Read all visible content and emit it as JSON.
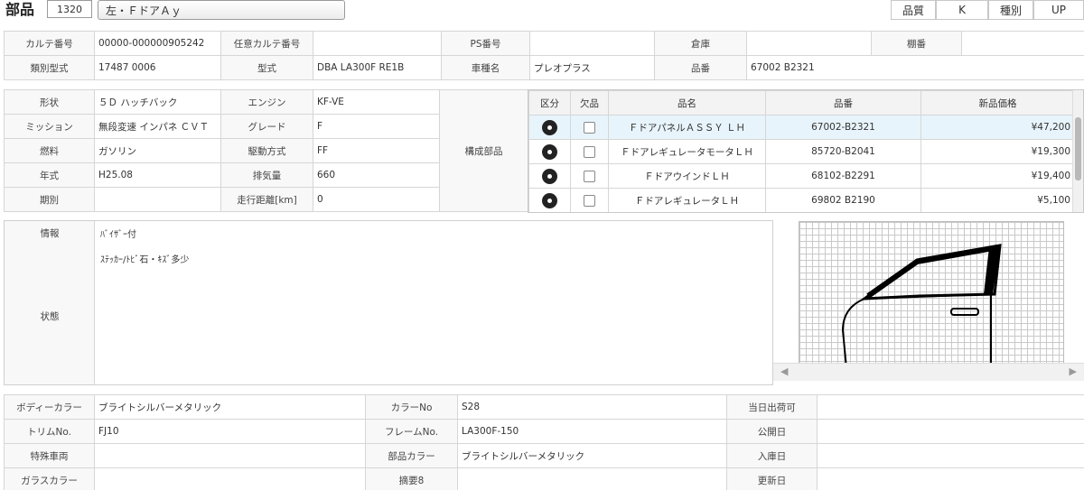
{
  "header": {
    "title": "部品",
    "code": "1320",
    "part_name": "左・ＦドアＡｙ",
    "quality_label": "品質",
    "quality_value": "K",
    "type_label": "種別",
    "type_value": "UP"
  },
  "row1": {
    "karte_no_label": "カルテ番号",
    "karte_no_value": "00000-000000905242",
    "any_karte_label": "任意カルテ番号",
    "any_karte_value": "",
    "ps_no_label": "PS番号",
    "ps_no_value": "",
    "warehouse_label": "倉庫",
    "warehouse_value": "",
    "shelf_label": "棚番",
    "shelf_value": ""
  },
  "row2": {
    "class_label": "類別型式",
    "class_value": "17487 0006",
    "model_label": "型式",
    "model_value": "DBA LA300F RE1B",
    "car_name_label": "車種名",
    "car_name_value": "プレオプラス",
    "part_no_label": "品番",
    "part_no_value": "67002 B2321"
  },
  "specs": {
    "shape_label": "形状",
    "shape_value": "５Ｄ ハッチバック",
    "engine_label": "エンジン",
    "engine_value": "KF-VE",
    "mission_label": "ミッション",
    "mission_value": "無段変速 インパネ ＣＶＴ",
    "grade_label": "グレード",
    "grade_value": "F",
    "fuel_label": "燃料",
    "fuel_value": "ガソリン",
    "drive_label": "駆動方式",
    "drive_value": "FF",
    "year_label": "年式",
    "year_value": "H25.08",
    "displacement_label": "排気量",
    "displacement_value": "660",
    "period_label": "期別",
    "period_value": "",
    "mileage_label": "走行距離[km]",
    "mileage_value": "0",
    "components_label": "構成部品"
  },
  "parts_table": {
    "headers": [
      "区分",
      "欠品",
      "品名",
      "品番",
      "新品価格"
    ],
    "rows": [
      {
        "name": "ＦドアパネルＡＳＳＹ ＬＨ",
        "number": "67002-B2321",
        "price": "¥47,200"
      },
      {
        "name": "ＦドアレギュレータモータＬＨ",
        "number": "85720-B2041",
        "price": "¥19,300"
      },
      {
        "name": "ＦドアウインドＬＨ",
        "number": "68102-B2291",
        "price": "¥19,400"
      },
      {
        "name": "ＦドアレギュレータＬＨ",
        "number": "69802 B2190",
        "price": "¥5,100"
      }
    ]
  },
  "info": {
    "info_label": "情報",
    "info_value": "ﾊﾞｲｻﾞｰ付",
    "note_value": "ｽﾃｯｶｰ/ﾄﾋﾞ石・ｷｽﾞ多少",
    "status_label": "状態"
  },
  "bottom": {
    "body_color_label": "ボディーカラー",
    "body_color_value": "ブライトシルバーメタリック",
    "color_no_label": "カラーNo",
    "color_no_value": "S28",
    "ship_date_label": "当日出荷可",
    "ship_date_value": "",
    "trim_label": "トリムNo.",
    "trim_value": "FJ10",
    "frame_label": "フレームNo.",
    "frame_value": "LA300F-150",
    "public_date_label": "公開日",
    "public_date_value": "",
    "special_label": "特殊車両",
    "special_value": "",
    "part_color_label": "部品カラー",
    "part_color_value": "ブライトシルバーメタリック",
    "arrival_label": "入庫日",
    "arrival_value": "",
    "glass_label": "ガラスカラー",
    "glass_value": "",
    "summary_label": "摘要8",
    "summary_value": "",
    "update_label": "更新日",
    "update_value": ""
  }
}
